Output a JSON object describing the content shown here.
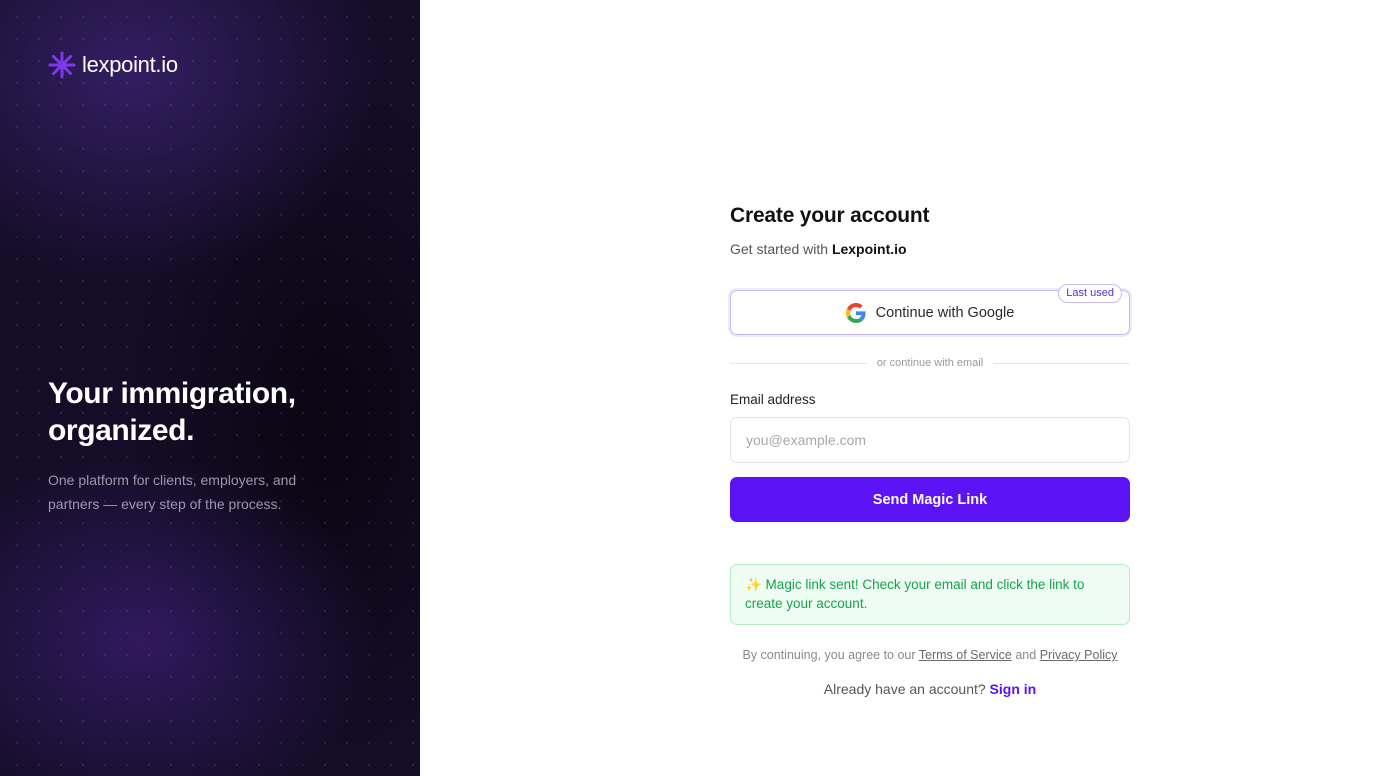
{
  "brand": {
    "name": "lexpoint.io",
    "logo_icon": "asterisk-icon",
    "accent_color": "#7c3aed"
  },
  "hero": {
    "title": "Your immigration, organized.",
    "subtitle": "One platform for clients, employers, and partners — every step of the process."
  },
  "form": {
    "title": "Create your account",
    "subtitle_prefix": "Get started with",
    "subtitle_brand": "Lexpoint.io",
    "google_button": {
      "label": "Continue with Google",
      "icon": "google-icon",
      "badge": "Last used"
    },
    "divider_text": "or continue with email",
    "email": {
      "label": "Email address",
      "placeholder": "you@example.com",
      "value": ""
    },
    "submit_label": "Send Magic Link",
    "submit_color": "#5b12f5",
    "success_message": "✨ Magic link sent! Check your email and click the link to create your account.",
    "terms": {
      "prefix": "By continuing, you agree to our",
      "terms_link": "Terms of Service",
      "conjunction": "and",
      "privacy_link": "Privacy Policy"
    },
    "signin": {
      "prompt": "Already have an account?",
      "link": "Sign in"
    }
  }
}
